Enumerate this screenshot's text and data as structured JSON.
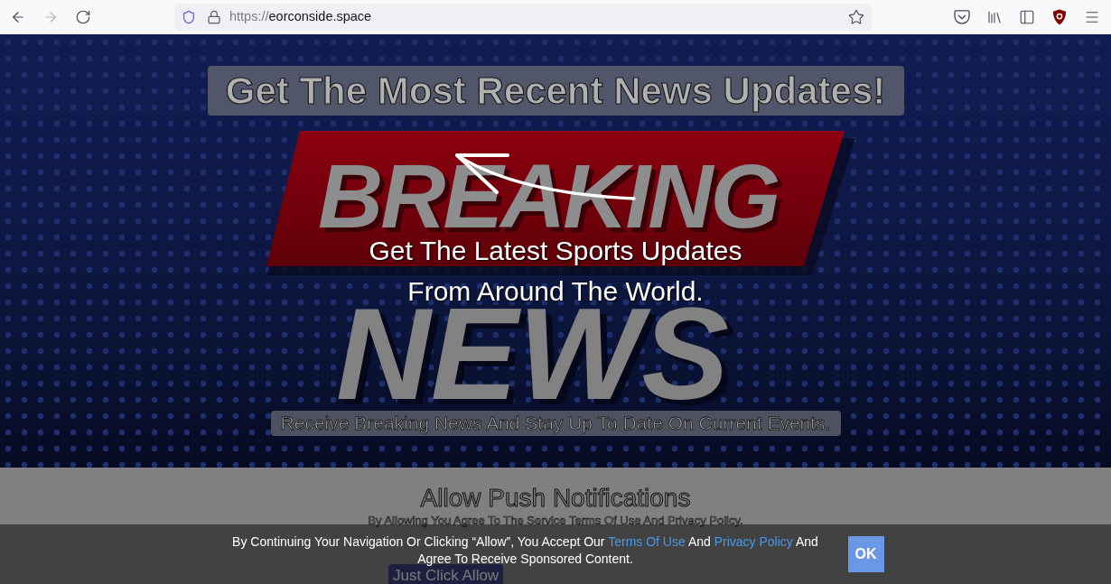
{
  "browser": {
    "nav_buttons": [
      {
        "kind": "back",
        "disabled": false
      },
      {
        "kind": "forward",
        "disabled": true
      },
      {
        "kind": "reload",
        "disabled": false
      }
    ],
    "url": {
      "scheme": "https://",
      "host": "eorconside.space"
    }
  },
  "hero": {
    "headline": "Get The Most Recent News Updates!",
    "banner": {
      "top_word": "BREAKING",
      "bottom_word": "NEWS"
    },
    "tagline": "Get The Latest Sports Updates From Around The World.",
    "subtitle": "Receive Breaking News And Stay Up To Date On Current Events."
  },
  "notification_prompt": {
    "title": "Allow Push Notifications",
    "subtitle": "By Allowing You Agree To The Service Terms Of Use And Privacy Policy.",
    "button": "Just Click Allow"
  },
  "cookie_bar": {
    "parts": [
      {
        "kind": "text",
        "text": "By Continuing Your Navigation Or Clicking “Allow”, You Accept Our"
      },
      {
        "kind": "link",
        "text": "Terms Of Use"
      },
      {
        "kind": "text",
        "text": "And"
      },
      {
        "kind": "link",
        "text": "Privacy Policy"
      },
      {
        "kind": "text",
        "text": "And Agree To Receive Sponsored Content."
      }
    ],
    "button": "OK"
  }
}
